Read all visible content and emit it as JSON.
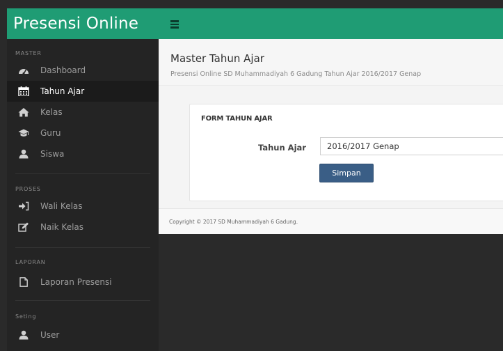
{
  "app": {
    "title": "Presensi Online"
  },
  "sidebar": {
    "sections": [
      {
        "label": "MASTER",
        "items": [
          {
            "label": "Dashboard",
            "icon": "dashboard-icon"
          },
          {
            "label": "Tahun Ajar",
            "icon": "calendar-icon",
            "active": true
          },
          {
            "label": "Kelas",
            "icon": "home-icon"
          },
          {
            "label": "Guru",
            "icon": "graduation-cap-icon"
          },
          {
            "label": "Siswa",
            "icon": "user-icon"
          }
        ]
      },
      {
        "label": "PROSES",
        "items": [
          {
            "label": "Wali Kelas",
            "icon": "sign-in-icon"
          },
          {
            "label": "Naik Kelas",
            "icon": "edit-icon"
          }
        ]
      },
      {
        "label": "LAPORAN",
        "items": [
          {
            "label": "Laporan Presensi",
            "icon": "file-icon"
          }
        ]
      },
      {
        "label": "Seting",
        "items": [
          {
            "label": "User",
            "icon": "user-icon"
          }
        ]
      }
    ]
  },
  "header": {
    "title": "Master Tahun Ajar",
    "subtitle": "Presensi Online SD Muhammadiyah 6 Gadung Tahun Ajar 2016/2017 Genap"
  },
  "form": {
    "title": "FORM TAHUN AJAR",
    "field_label": "Tahun Ajar",
    "field_value": "2016/2017 Genap",
    "submit_label": "Simpan"
  },
  "footer": {
    "text": "Copyright © 2017 SD Muhammadiyah 6 Gadung."
  },
  "colors": {
    "brand": "#1f9c74",
    "sidebar": "#242424",
    "button": "#3a5e86"
  }
}
